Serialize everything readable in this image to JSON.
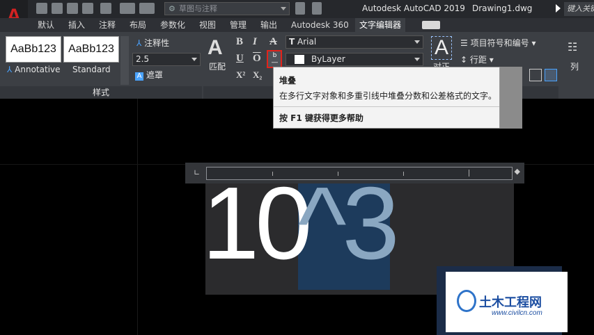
{
  "titlebar": {
    "app_title": "Autodesk AutoCAD 2019",
    "document": "Drawing1.dwg",
    "workspace": "草图与注释",
    "search_placeholder": "键入关键字或短语"
  },
  "tabs": [
    "默认",
    "插入",
    "注释",
    "布局",
    "参数化",
    "视图",
    "管理",
    "输出",
    "Autodesk 360",
    "文字编辑器"
  ],
  "active_tab": "文字编辑器",
  "style_panel": {
    "samples": [
      "AaBb123",
      "AaBb123"
    ],
    "sample_names": [
      "Annotative",
      "Standard"
    ],
    "annotative_label": "注释性",
    "height_value": "2.5",
    "mask_label": "遮罩",
    "panel_title": "样式"
  },
  "format_panel": {
    "match_label": "匹配",
    "font_value": "Arial",
    "color_value": "ByLayer",
    "align_label": "对正",
    "bullets_label": "项目符号和编号",
    "spacing_label": "行距",
    "column_label": "列"
  },
  "tooltip": {
    "title": "堆叠",
    "description": "在多行文字对象和多重引线中堆叠分数和公差格式的文字。",
    "help": "按 F1 键获得更多帮助"
  },
  "editor": {
    "text_normal": "10",
    "text_selected": "^3"
  },
  "watermark": {
    "title": "土木工程网",
    "url": "www.civilcn.com"
  },
  "colors": {
    "accent": "#d32222",
    "selection": "#1d3b5c",
    "highlight_border": "#e2231a"
  }
}
